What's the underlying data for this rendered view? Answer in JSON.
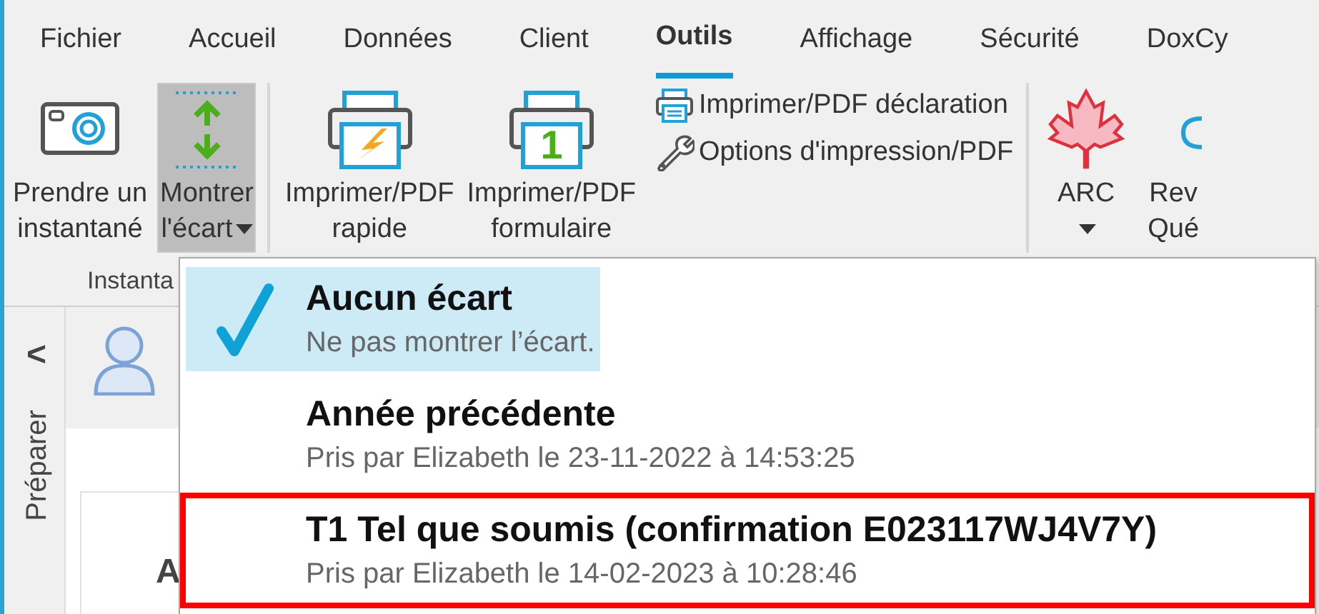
{
  "menu_tabs": [
    {
      "label": "Fichier",
      "selected": false
    },
    {
      "label": "Accueil",
      "selected": false
    },
    {
      "label": "Données",
      "selected": false
    },
    {
      "label": "Client",
      "selected": false
    },
    {
      "label": "Outils",
      "selected": true
    },
    {
      "label": "Affichage",
      "selected": false
    },
    {
      "label": "Sécurité",
      "selected": false
    },
    {
      "label": "DoxCy",
      "selected": false
    }
  ],
  "ribbon": {
    "items": [
      {
        "kind": "snapshot",
        "label": "Prendre un\ninstantané",
        "pressed": false,
        "dropdown": false
      },
      {
        "kind": "gap",
        "label": "Montrer\nl'écart",
        "pressed": true,
        "dropdown": true
      },
      {
        "kind": "separator"
      },
      {
        "kind": "quick-print",
        "label": "Imprimer/PDF\nrapide",
        "pressed": false,
        "dropdown": false
      },
      {
        "kind": "form-print",
        "icon_label": "1",
        "label": "Imprimer/PDF\nformulaire",
        "pressed": false,
        "dropdown": false
      },
      {
        "kind": "stack",
        "buttons": [
          {
            "kind": "print",
            "label": "Imprimer/PDF déclaration"
          },
          {
            "kind": "options",
            "label": "Options d'impression/PDF"
          }
        ]
      },
      {
        "kind": "separator"
      },
      {
        "kind": "agency",
        "label": "ARC",
        "pressed": false,
        "dropdown": true
      },
      {
        "kind": "partial",
        "label": "Rev\nQué",
        "pressed": false,
        "dropdown": false
      }
    ],
    "group_label": "Instanta"
  },
  "side_panel": {
    "collapse": "<",
    "label": "Préparer"
  },
  "content": {
    "card_heading": "A"
  },
  "dropdown_menu": {
    "items": [
      {
        "title": "Aucun écart",
        "subtitle": "Ne pas montrer l’écart.",
        "selected": true,
        "outlined": false
      },
      {
        "title": "Année précédente",
        "subtitle": "Pris par Elizabeth le 23-11-2022 à 14:53:25",
        "selected": false,
        "outlined": false
      },
      {
        "title": "T1 Tel que soumis (confirmation E023117WJ4V7Y)",
        "subtitle": "Pris par Elizabeth le 14-02-2023 à 10:28:46",
        "selected": false,
        "outlined": true
      }
    ]
  }
}
